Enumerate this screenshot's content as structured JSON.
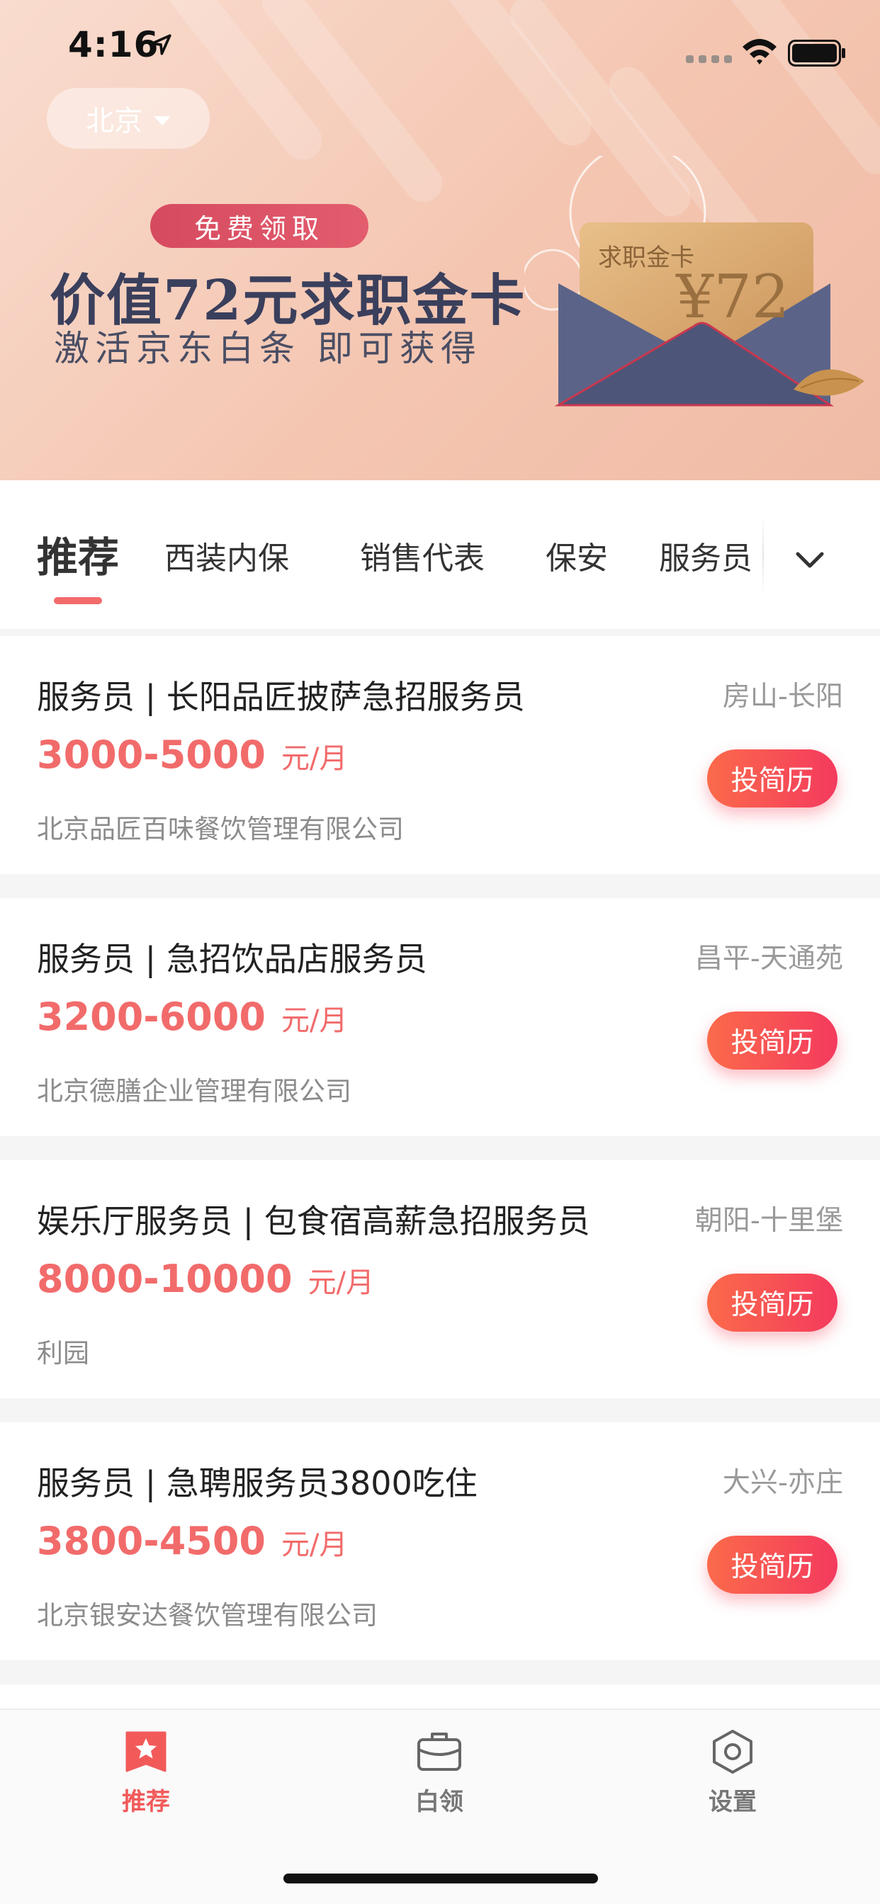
{
  "status_bar": {
    "time": "4:16"
  },
  "header": {
    "city": "北京"
  },
  "banner": {
    "tag": "免费领取",
    "title": "价值72元求职金卡",
    "subtitle": "激活京东白条  即可获得",
    "card_label": "求职金卡",
    "card_amount": "¥72"
  },
  "tabs": {
    "active": "推荐",
    "items": [
      "西装内保",
      "销售代表",
      "保安",
      "服务员"
    ]
  },
  "jobs": [
    {
      "title": "服务员 | 长阳品匠披萨急招服务员",
      "area": "房山-长阳",
      "salary": "3000-5000",
      "unit": "元/月",
      "company": "北京品匠百味餐饮管理有限公司",
      "apply": "投简历"
    },
    {
      "title": "服务员 | 急招饮品店服务员",
      "area": "昌平-天通苑",
      "salary": "3200-6000",
      "unit": "元/月",
      "company": "北京德膳企业管理有限公司",
      "apply": "投简历"
    },
    {
      "title": "娱乐厅服务员 | 包食宿高薪急招服务员",
      "area": "朝阳-十里堡",
      "salary": "8000-10000",
      "unit": "元/月",
      "company": "利园",
      "apply": "投简历"
    },
    {
      "title": "服务员 | 急聘服务员3800吃住",
      "area": "大兴-亦庄",
      "salary": "3800-4500",
      "unit": "元/月",
      "company": "北京银安达餐饮管理有限公司",
      "apply": "投简历"
    }
  ],
  "tabbar": {
    "items": [
      {
        "label": "推荐",
        "icon": "star-bookmark-icon"
      },
      {
        "label": "白领",
        "icon": "briefcase-icon"
      },
      {
        "label": "设置",
        "icon": "hexagon-settings-icon"
      }
    ]
  },
  "colors": {
    "accent": "#f26b6b",
    "button_start": "#fb6a4a",
    "button_end": "#f43a5e",
    "banner_bg": "#f4c6b1"
  }
}
